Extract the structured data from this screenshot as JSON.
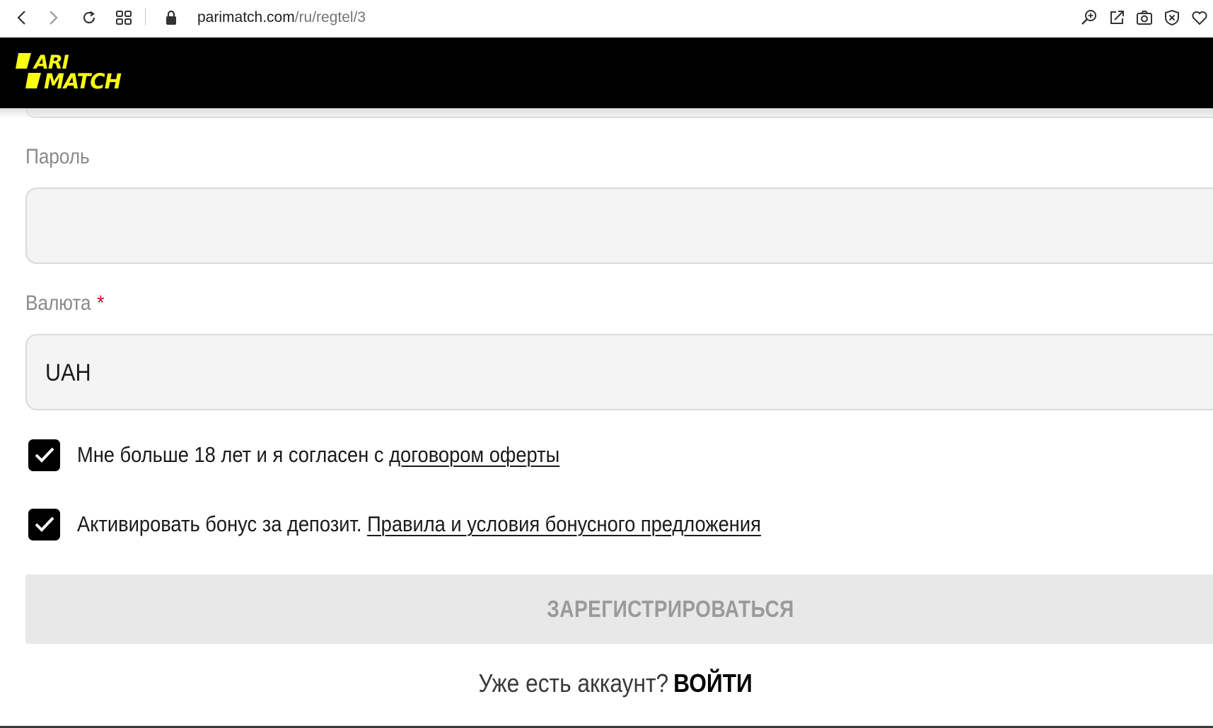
{
  "browser": {
    "url_host": "parimatch.com",
    "url_path": "/ru/regtel/3",
    "icons": [
      "back-icon",
      "forward-icon",
      "reload-icon",
      "tabs-grid-icon",
      "lock-icon",
      "zoom-icon",
      "share-edit-icon",
      "camera-icon",
      "shield-icon",
      "heart-icon"
    ]
  },
  "header": {
    "logo_text": "PARI MATCH",
    "accent_color": "#f8ff13"
  },
  "form": {
    "password_label": "Пароль",
    "password_value": "",
    "currency_label": "Валюта",
    "currency_required": "*",
    "currency_value": "UAH",
    "age_checkbox": {
      "checked": true,
      "text": "Мне больше 18 лет и я согласен с ",
      "link": "договором оферты"
    },
    "bonus_checkbox": {
      "checked": true,
      "text": "Активировать бонус за депозит. ",
      "link": "Правила и условия бонусного предложения"
    },
    "register_button": "ЗАРЕГИСТРИРОВАТЬСЯ",
    "login_prompt": "Уже есть аккаунт?",
    "login_link": "ВОЙТИ"
  }
}
